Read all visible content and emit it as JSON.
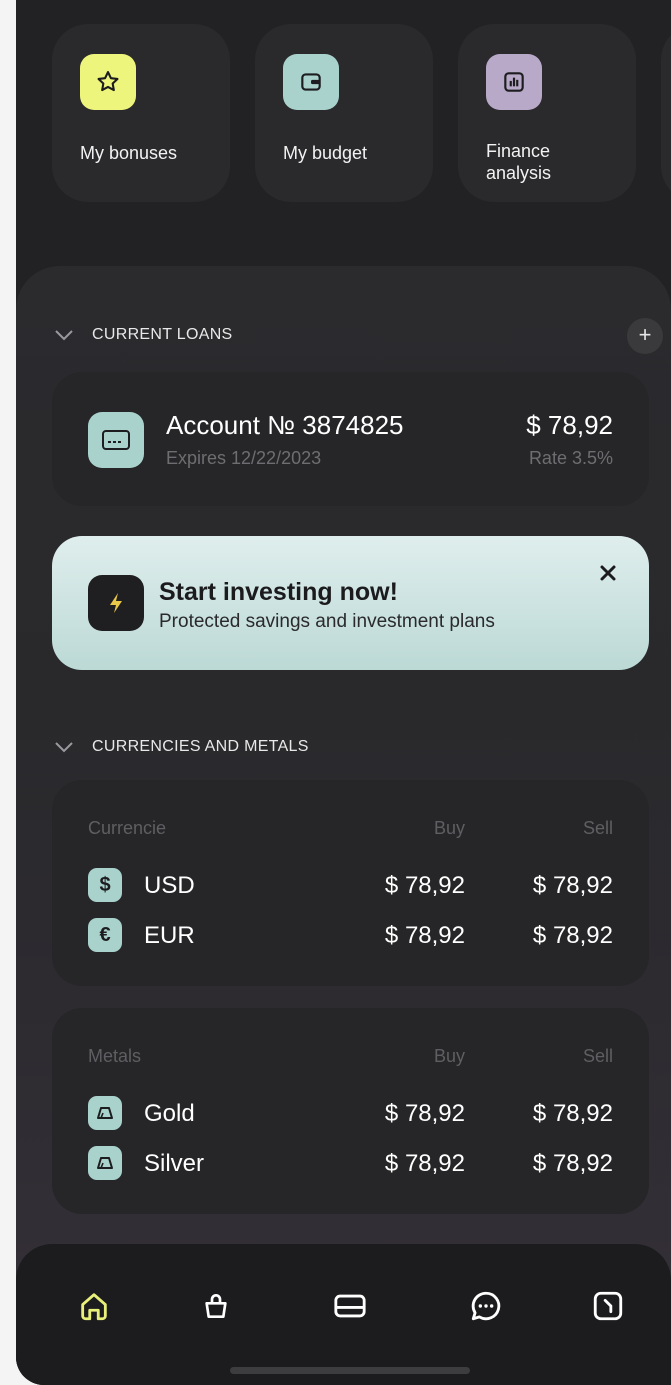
{
  "tiles": [
    {
      "label": "My bonuses",
      "icon": "star-icon",
      "color": "#eef57d"
    },
    {
      "label": "My budget",
      "icon": "wallet-icon",
      "color": "#a9d2cd"
    },
    {
      "label": "Finance analysis",
      "icon": "chart-icon",
      "color": "#b9a9c9"
    }
  ],
  "loans": {
    "title": "CURRENT LOANS",
    "add_label": "+",
    "account": "Account № 3874825",
    "expires": "Expires 12/22/2023",
    "amount": "$ 78,92",
    "rate": "Rate 3.5%"
  },
  "promo": {
    "title": "Start investing now!",
    "subtitle": "Protected savings and investment plans"
  },
  "currencies": {
    "title": "CURRENCIES AND METALS",
    "currency_header": {
      "name": "Currencie",
      "buy": "Buy",
      "sell": "Sell"
    },
    "currency_rows": [
      {
        "symbol": "$",
        "name": "USD",
        "buy": "$ 78,92",
        "sell": "$ 78,92"
      },
      {
        "symbol": "€",
        "name": "EUR",
        "buy": "$ 78,92",
        "sell": "$ 78,92"
      }
    ],
    "metal_header": {
      "name": "Metals",
      "buy": "Buy",
      "sell": "Sell"
    },
    "metal_rows": [
      {
        "name": "Gold",
        "buy": "$ 78,92",
        "sell": "$ 78,92"
      },
      {
        "name": "Silver",
        "buy": "$ 78,92",
        "sell": "$ 78,92"
      }
    ]
  },
  "nav": {
    "items": [
      "home-icon",
      "bag-icon",
      "card-icon",
      "chat-icon",
      "clock-icon"
    ],
    "active_color": "#e8f07a"
  }
}
